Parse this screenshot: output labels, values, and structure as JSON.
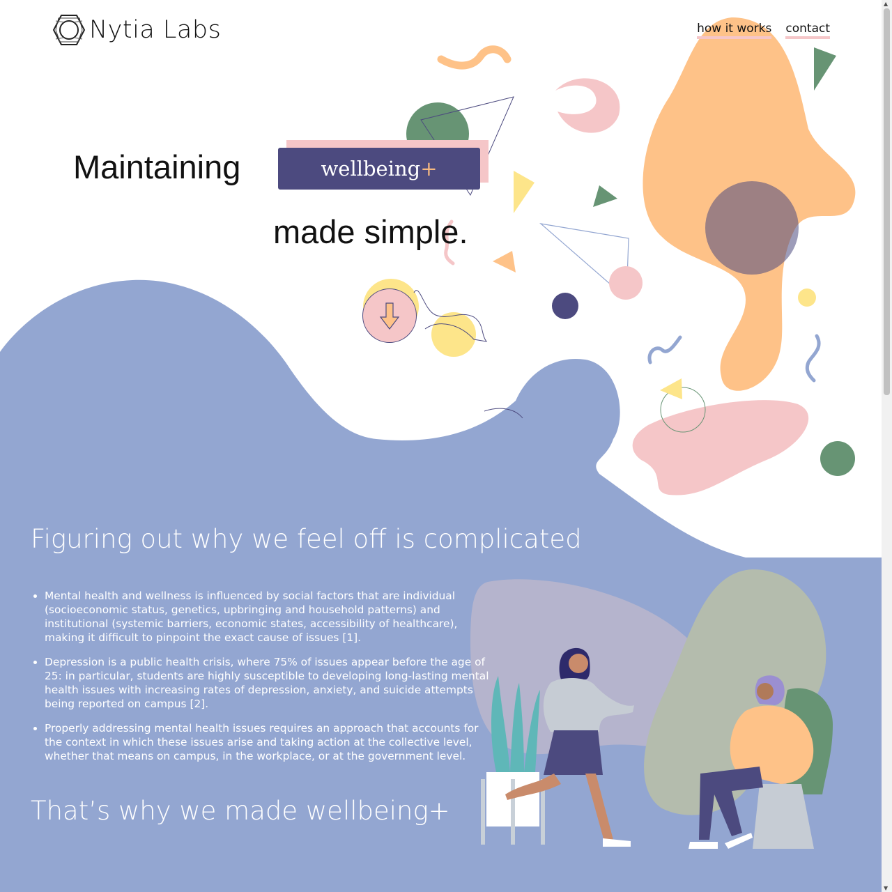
{
  "brand": {
    "name": "Nytia Labs",
    "logo_icon": "hexagon-wire-logo"
  },
  "nav": {
    "items": [
      {
        "label": "how it works"
      },
      {
        "label": "contact"
      }
    ]
  },
  "hero": {
    "line1": "Maintaining",
    "badge": {
      "word": "wellbeing",
      "plus": "+"
    },
    "line2": "made simple.",
    "scroll_button_icon": "arrow-down-icon"
  },
  "section": {
    "heading": "Figuring out why we feel off is complicated",
    "bullets": [
      "Mental health and wellness is influenced by social factors that are individual (socioeconomic status, genetics, upbringing and household patterns) and institutional (systemic barriers, economic states, accessibility of healthcare), making it difficult to pinpoint the exact cause of issues [1].",
      "Depression is a public health crisis, where 75% of issues appear before the age of 25: in particular, students are highly susceptible to developing long-lasting mental health issues with increasing rates of depression, anxiety, and suicide attempts being reported on campus [2].",
      "Properly addressing mental health issues requires an approach that accounts for the context in which these issues arise and taking action at the collective level, whether that means on campus, in the workplace, or at the government level."
    ],
    "closing": "That’s why we made wellbeing+"
  },
  "colors": {
    "blue": "#93a6d1",
    "navy": "#4c4a7f",
    "peach": "#fec288",
    "pink": "#f5c6c8",
    "green": "#679474",
    "yellow": "#fde58a"
  }
}
